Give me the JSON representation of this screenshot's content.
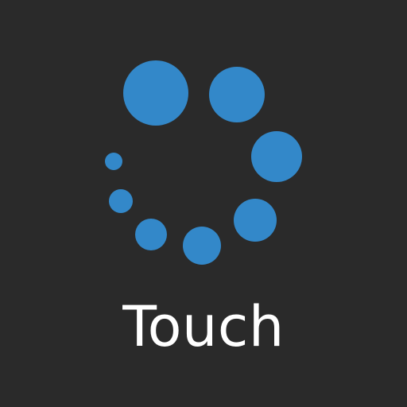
{
  "app": {
    "label": "Touch"
  },
  "colors": {
    "background": "#2a2a2a",
    "accent": "#3388c9",
    "text": "#ffffff"
  },
  "icon": {
    "name": "loading-spinner-icon"
  }
}
